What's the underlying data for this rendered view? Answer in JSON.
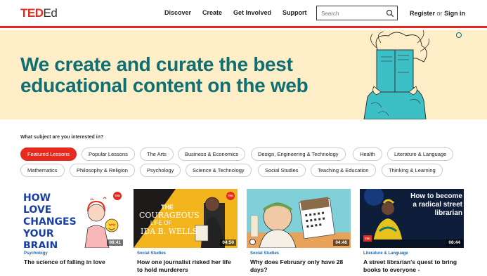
{
  "header": {
    "logo_ted": "TED",
    "logo_ed": "Ed",
    "nav": [
      "Discover",
      "Create",
      "Get Involved",
      "Support"
    ],
    "search_placeholder": "Search",
    "register": "Register",
    "or": "or",
    "sign_in": "Sign in"
  },
  "hero": {
    "headline_line1": "We create and curate the best",
    "headline_line2": "educational content on the web"
  },
  "subjects": {
    "prompt": "What subject are you interested in?",
    "items": [
      "Featured Lessons",
      "Popular Lessons",
      "The Arts",
      "Business & Economics",
      "Design, Engineering & Technology",
      "Health",
      "Literature & Language",
      "Mathematics",
      "Philosophy & Religion",
      "Psychology",
      "Science & Technology",
      "Social Studies",
      "Teaching & Education",
      "Thinking & Learning"
    ],
    "active": "Featured Lessons"
  },
  "lessons": [
    {
      "thumb_text": "HOW LOVE CHANGES YOUR BRAIN",
      "duration": "06:41",
      "category": "Psychology",
      "title": "The science of falling in love"
    },
    {
      "thumb_text_1": "THE",
      "thumb_text_2": "COURAGEOUS",
      "thumb_text_3": "LIFE OF",
      "thumb_text_4": "IDA B. WELLS",
      "duration": "04:50",
      "category": "Social Studies",
      "title": "How one journalist risked her life to hold murderers"
    },
    {
      "duration": "04:46",
      "category": "Social Studies",
      "title": "Why does February only have 28 days?"
    },
    {
      "thumb_text": "How to become a radical street librarian",
      "duration": "08:44",
      "category": "Literature & Language",
      "title": "A street librarian's quest to bring books to everyone -"
    }
  ],
  "colors": {
    "accent": "#e62b1e",
    "hero_bg": "#fdeec8",
    "headline": "#0f6f72",
    "category": "#2468a8"
  }
}
